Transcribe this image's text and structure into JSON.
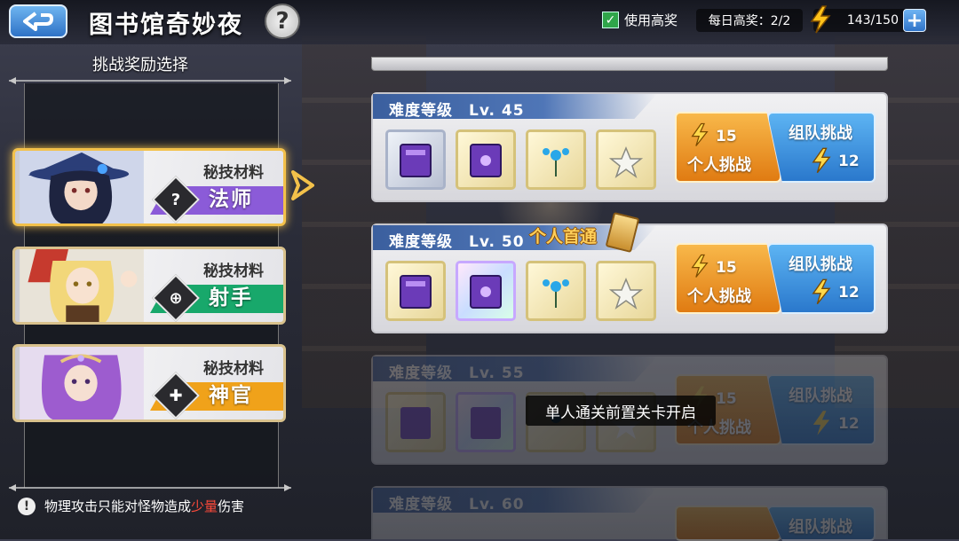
{
  "header": {
    "title": "图书馆奇妙夜",
    "help_symbol": "?",
    "use_reward_label": "使用高奖",
    "use_reward_checked": true,
    "daily_reward": "每日高奖：2/2",
    "energy": "143/150",
    "plus": "+"
  },
  "left": {
    "section_title": "挑战奖励选择",
    "cards": [
      {
        "subtitle": "秘技材料",
        "name": "法师",
        "badge": "?",
        "selected": true,
        "band_color": "#8b5bd8"
      },
      {
        "subtitle": "秘技材料",
        "name": "射手",
        "badge": "⊕",
        "selected": false,
        "band_color": "#18a86b"
      },
      {
        "subtitle": "秘技材料",
        "name": "神官",
        "badge": "✚",
        "selected": false,
        "band_color": "#f0a21a"
      }
    ],
    "hint_icon": "!",
    "hint_before": "物理攻击只能对怪物造成",
    "hint_highlight": "少量",
    "hint_after": "伤害"
  },
  "levels": [
    {
      "label": "难度等级　Lv. 45",
      "first_clear": "",
      "solo_cost": "15",
      "solo_label": "个人挑战",
      "team_label": "组队挑战",
      "team_cost": "12",
      "locked": false
    },
    {
      "label": "难度等级　Lv. 50",
      "first_clear": "个人首通",
      "solo_cost": "15",
      "solo_label": "个人挑战",
      "team_label": "组队挑战",
      "team_cost": "12",
      "locked": false
    },
    {
      "label": "难度等级　Lv. 55",
      "first_clear": "",
      "solo_cost": "15",
      "solo_label": "个人挑战",
      "team_label": "组队挑战",
      "team_cost": "12",
      "locked": true
    },
    {
      "label": "难度等级　Lv. 60",
      "first_clear": "",
      "solo_cost": "",
      "solo_label": "",
      "team_label": "组队挑战",
      "team_cost": "",
      "locked": true
    }
  ],
  "toast": "单人通关前置关卡开启",
  "colors": {
    "accent_blue": "#2e72c6",
    "solo_orange": "#e07b12",
    "gold": "#f3c14a",
    "highlight_red": "#ff4a3a"
  }
}
